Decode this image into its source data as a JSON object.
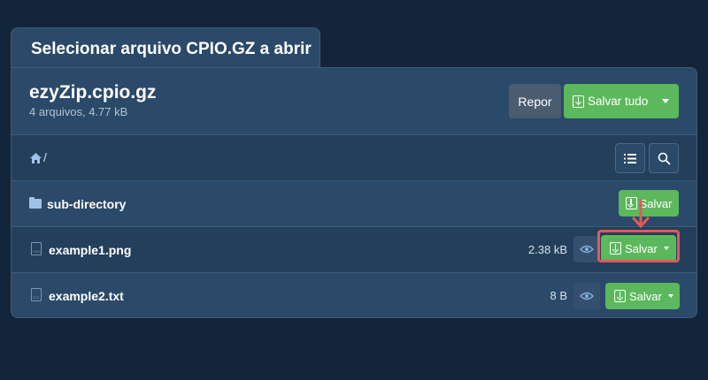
{
  "dialog": {
    "tab_title": "Selecionar arquivo CPIO.GZ a abrir"
  },
  "archive": {
    "name": "ezyZip.cpio.gz",
    "meta": "4 arquivos, 4.77 kB",
    "reset_label": "Repor",
    "save_all_label": "Salvar tudo"
  },
  "path_bar": {
    "separator": "/"
  },
  "rows": [
    {
      "type": "folder",
      "name": "sub-directory",
      "size": "",
      "save_label": "Salvar",
      "icon": "folder-icon"
    },
    {
      "type": "file",
      "name": "example1.png",
      "size": "2.38 kB",
      "save_label": "Salvar",
      "icon": "png-file-icon",
      "file_tag": "PNG"
    },
    {
      "type": "file",
      "name": "example2.txt",
      "size": "8 B",
      "save_label": "Salvar",
      "icon": "txt-file-icon",
      "file_tag": "TXT"
    }
  ],
  "colors": {
    "background": "#13253a",
    "panel": "#2b4968",
    "accent_green": "#5cb85c",
    "highlight_red": "#e15a5a"
  }
}
